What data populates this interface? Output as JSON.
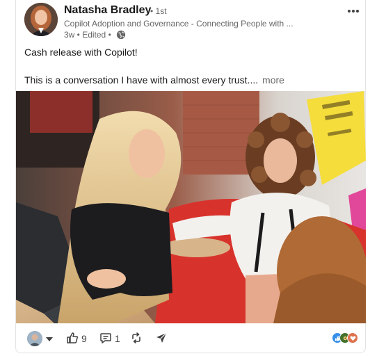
{
  "post": {
    "author": "Natasha Bradley",
    "degree": "• 1st",
    "headline": "Copilot Adoption and Governance - Connecting People with ...",
    "time": "3w • Edited •",
    "text_line1": "Cash release with Copilot!",
    "text_line2": "This is a conversation I have with almost every trust....",
    "see_more": "more"
  },
  "actions": {
    "likes": "9",
    "comments": "1"
  },
  "icons": {
    "more_menu": "ellipsis-icon",
    "visibility": "globe-icon",
    "dropdown": "caret-down-icon",
    "like": "thumbs-up-icon",
    "comment": "comment-icon",
    "repost": "repost-icon",
    "send": "send-icon",
    "reactions": [
      "like-reaction-icon",
      "celebrate-reaction-icon",
      "love-reaction-icon"
    ]
  },
  "colors": {
    "text": "#191919",
    "secondary": "#666666",
    "like_blue": "#378fe9",
    "celebrate_green": "#44712e",
    "love_red": "#df704d"
  }
}
